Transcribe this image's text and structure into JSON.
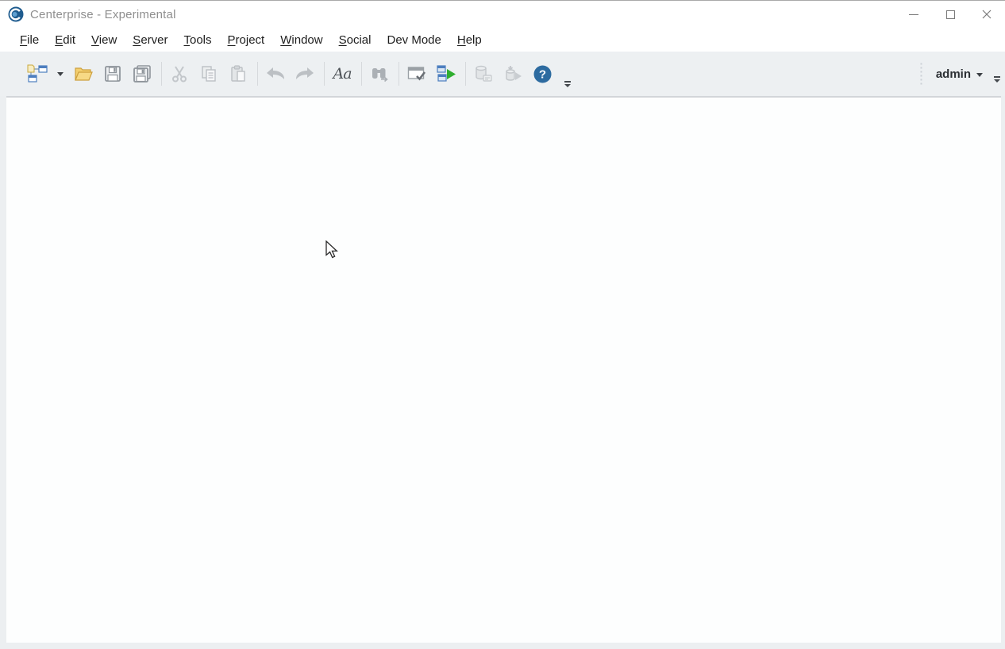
{
  "window": {
    "title": "Centerprise - Experimental",
    "logo": "centerprise-logo",
    "controls": [
      "minimize",
      "maximize",
      "close"
    ]
  },
  "menubar": {
    "items": [
      {
        "label": "File",
        "pre": "",
        "key": "F",
        "post": "ile"
      },
      {
        "label": "Edit",
        "pre": "",
        "key": "E",
        "post": "dit"
      },
      {
        "label": "View",
        "pre": "",
        "key": "V",
        "post": "iew"
      },
      {
        "label": "Server",
        "pre": "",
        "key": "S",
        "post": "erver"
      },
      {
        "label": "Tools",
        "pre": "",
        "key": "T",
        "post": "ools"
      },
      {
        "label": "Project",
        "pre": "",
        "key": "P",
        "post": "roject"
      },
      {
        "label": "Window",
        "pre": "",
        "key": "W",
        "post": "indow"
      },
      {
        "label": "Social",
        "pre": "",
        "key": "S",
        "post": "ocial"
      },
      {
        "label": "Dev Mode",
        "pre": "Dev Mode",
        "key": "",
        "post": ""
      },
      {
        "label": "Help",
        "pre": "",
        "key": "H",
        "post": "elp"
      }
    ]
  },
  "toolbar": {
    "buttons": [
      {
        "name": "new-flow-document",
        "enabled": true
      },
      {
        "name": "new-flow-dropdown",
        "enabled": true
      },
      {
        "name": "open",
        "enabled": true
      },
      {
        "name": "save",
        "enabled": true
      },
      {
        "name": "save-all",
        "enabled": true
      },
      {
        "name": "cut",
        "enabled": false
      },
      {
        "name": "copy",
        "enabled": false
      },
      {
        "name": "paste",
        "enabled": false
      },
      {
        "name": "undo",
        "enabled": false
      },
      {
        "name": "redo",
        "enabled": false
      },
      {
        "name": "font-settings",
        "enabled": true
      },
      {
        "name": "find",
        "enabled": false
      },
      {
        "name": "verify",
        "enabled": true
      },
      {
        "name": "run",
        "enabled": true
      },
      {
        "name": "database-source",
        "enabled": false
      },
      {
        "name": "deploy-job",
        "enabled": false
      },
      {
        "name": "help",
        "enabled": true
      },
      {
        "name": "toolbar-overflow",
        "enabled": true
      }
    ],
    "font_icon_label": "Aa",
    "help_glyph": "?",
    "user": {
      "label": "admin"
    }
  },
  "colors": {
    "toolbar_bg": "#edf0f2",
    "frame_bg": "#eceff1",
    "accent_blue": "#2d6ba0",
    "window_blue": "#4d7ebf",
    "run_green": "#2fae2f",
    "folder_yellow": "#f0c352",
    "disabled_icon": "#c3c7cb",
    "enabled_icon": "#8f959b",
    "menu_text": "#1c1c1c",
    "title_text": "#8f8f8f"
  }
}
